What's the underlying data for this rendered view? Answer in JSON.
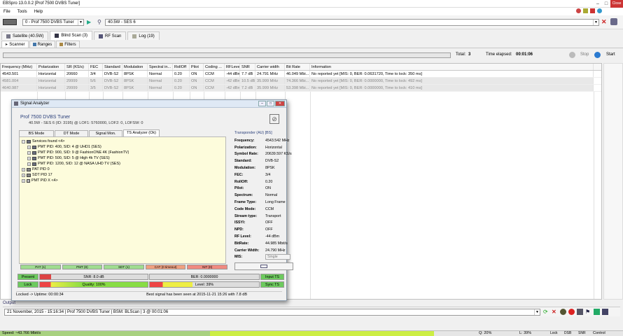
{
  "window": {
    "title": "EBSpro 13.0.0.2 [Prof 7500 DVBS Tuner]",
    "close_label": "Close"
  },
  "menu": [
    "File",
    "Tools",
    "Help"
  ],
  "tuner_select": "0 - Prof 7500 DVBS Tuner",
  "satellite_select": "40.5W - SES 6",
  "main_tabs": [
    {
      "label": "Satellite (40.5W)",
      "icon": "satellite-icon"
    },
    {
      "label": "Blind Scan (3)",
      "icon": "scan-icon"
    },
    {
      "label": "RF Scan",
      "icon": "rf-icon"
    },
    {
      "label": "Log (19)",
      "icon": "log-icon"
    }
  ],
  "sub_tabs": [
    {
      "label": "Scanner",
      "icon": "scanner-icon"
    },
    {
      "label": "Ranges",
      "icon": "ranges-icon"
    },
    {
      "label": "Filters",
      "icon": "filter-icon"
    }
  ],
  "scan": {
    "total_label": "Total:",
    "total": "3",
    "elapsed_label": "Time elapsed:",
    "elapsed": "00:01:06",
    "stop_label": "Stop",
    "start_label": "Start"
  },
  "grid": {
    "columns": [
      "Frequency (MHz)",
      "Polarization",
      "SR (KS/s)",
      "FEC",
      "Standard",
      "Modulation",
      "Spectral in...",
      "RollOff",
      "Pilot",
      "Coding ...",
      "RFLevel",
      "SNR",
      "Carrier width",
      "Bit Rate",
      "Information"
    ],
    "rows": [
      [
        "4543.501",
        "Horizontal",
        "20660",
        "3/4",
        "DVB-S2",
        "8PSK",
        "Normal",
        "0.20",
        "ON",
        "CCM",
        "-44 dBm",
        "7.7 dB",
        "24.791 MHz",
        "46.049 Mbi...",
        "No reported yet [MIS: 0, BER: 0.0631720, Time to lock: 350 ms]"
      ],
      [
        "4581.004",
        "Horizontal",
        "29999",
        "5/6",
        "DVB-S2",
        "8PSK",
        "Normal",
        "0.20",
        "ON",
        "CCM",
        "-42 dBm",
        "10.5 dB",
        "35.999 MHz",
        "74.366 Mbi...",
        "No reported yet [MIS: 0, BER: 0.0000000, Time to lock: 492 ms]"
      ],
      [
        "4640.987",
        "Horizontal",
        "29999",
        "3/5",
        "DVB-S2",
        "8PSK",
        "Normal",
        "0.20",
        "ON",
        "CCM",
        "-42 dBm",
        "7.2 dB",
        "35.999 MHz",
        "53.398 Mbi...",
        "No reported yet [MIS: 0, BER: 0.0000000, Time to lock: 410 ms]"
      ]
    ]
  },
  "analyzer": {
    "title": "Signal Analyzer",
    "tuner_name": "Prof 7500 DVBS Tuner",
    "subtitle": "40.5W - SES 6 (ID: 3195) @ LOF1: 5760000, LOF2: 0, LOFSW: 0",
    "tabs": [
      "BS Mode",
      "DT Mode",
      "Signal Mon.",
      "TS Analyzer (Ok)"
    ],
    "tree": [
      {
        "label": "Services found <4>",
        "level": 0,
        "icon": "folder"
      },
      {
        "label": "PMT PID: 400, SID: 4 @ UHD1 (SES)",
        "level": 1,
        "icon": "tv"
      },
      {
        "label": "PMT PID: 900, SID: 9 @ FashionONE 4K (FashionTV)",
        "level": 1,
        "icon": "tv"
      },
      {
        "label": "PMT PID: 500, SID: 5 @ High 4k TV (SES)",
        "level": 1,
        "icon": "tv"
      },
      {
        "label": "PMT PID: 1200, SID: 12 @ NASA UHD TV (SES)",
        "level": 1,
        "icon": "tv"
      },
      {
        "label": "PAT PID 0",
        "level": 0,
        "icon": "table"
      },
      {
        "label": "SDT PID 17",
        "level": 0,
        "icon": "table"
      },
      {
        "label": "PMT PID X <4>",
        "level": 0,
        "icon": "list"
      }
    ],
    "transponder_header": "Transponder (AU) [BS]",
    "transponder": [
      [
        "Frequency:",
        "4543.542 MHz"
      ],
      [
        "Polarization:",
        "Horizontal"
      ],
      [
        "Symbol Rate:",
        "20639.597 KS/s"
      ],
      [
        "Standard:",
        "DVB-S2"
      ],
      [
        "Modulation:",
        "8PSK"
      ],
      [
        "FEC:",
        "3/4"
      ],
      [
        "RollOff:",
        "0.20"
      ],
      [
        "Pilot:",
        "ON"
      ],
      [
        "Spectrum:",
        "Normal"
      ],
      [
        "Frame Type:",
        "Long Frame"
      ],
      [
        "Code Mode:",
        "CCM"
      ],
      [
        "Stream type:",
        "Transport"
      ],
      [
        "ISSYI:",
        "OFF"
      ],
      [
        "NPD:",
        "OFF"
      ],
      [
        "RF Level:",
        "-44 dBm"
      ],
      [
        "BitRate:",
        "44.985 Mbit/s"
      ],
      [
        "Carrier Width:",
        "24.790 MHz"
      ],
      [
        "MIS:",
        ""
      ]
    ],
    "mis_value": "Single",
    "pid_status": [
      {
        "label": "PAT (1)",
        "color": "#9fdc8f"
      },
      {
        "label": "PMT (8)",
        "color": "#9fdc8f"
      },
      {
        "label": "SDT (1)",
        "color": "#9fdc8f"
      },
      {
        "label": "CAT (0 timeout)",
        "color": "#f0a080"
      },
      {
        "label": "NIT (0)",
        "color": "#f08a80"
      }
    ],
    "present_label": "Present",
    "snr_label": "SNR: 8.0 dB",
    "ber_label": "BER: 0.0000000",
    "input_ts_label": "Input TS",
    "lock_label": "Lock",
    "quality_label": "Quality: 100%",
    "level_label": "Level: 39%",
    "sync_ts_label": "Sync TS",
    "quality": 100,
    "level": 39,
    "locked_status": "Locked -> Uptime: 00:00:34",
    "best_signal": "Best signal has been seen at 2015-11-21 15:26 with 7.8 dB"
  },
  "output": {
    "label": "Output",
    "line": "21 November, 2015 - 15:16:34 | Prof 7500 DVBS Tuner | BSM: BLScan | 3 @ 00:01:06"
  },
  "status": {
    "speed": "Speed: ~43.766 Mbit/s",
    "q": "Q: 20%",
    "l": "L: 39%",
    "lock": "Lock",
    "dsb": "DSB",
    "snr": "SNR",
    "control": "Control"
  }
}
